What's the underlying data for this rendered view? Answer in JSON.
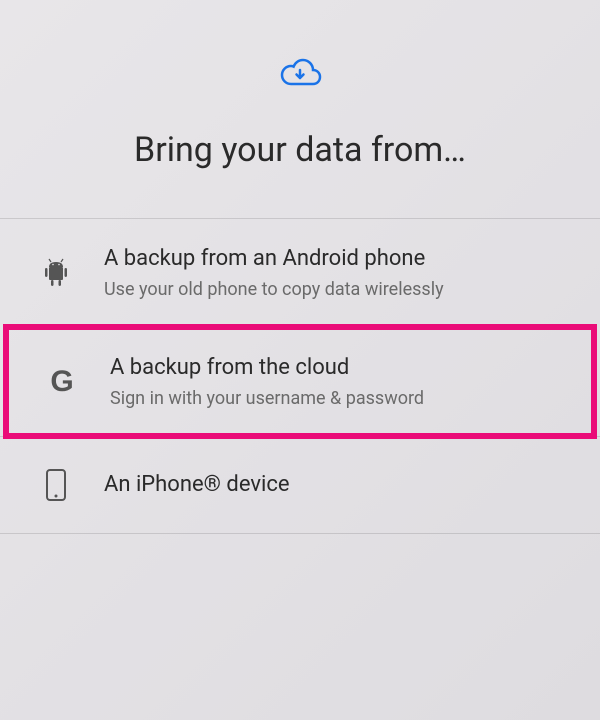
{
  "header": {
    "title": "Bring your data from…"
  },
  "options": [
    {
      "title": "A backup from an Android phone",
      "subtitle": "Use your old phone to copy data wirelessly"
    },
    {
      "title": "A backup from the cloud",
      "subtitle": "Sign in with your username & password"
    },
    {
      "title": "An iPhone® device",
      "subtitle": ""
    }
  ],
  "colors": {
    "highlight": "#ea0c78",
    "iconBlue": "#1a73e8"
  }
}
